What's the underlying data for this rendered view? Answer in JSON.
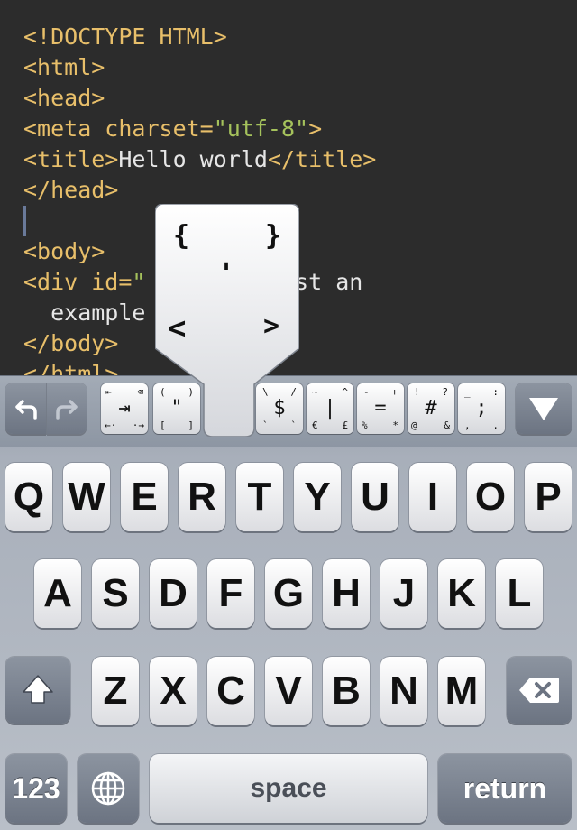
{
  "editor": {
    "lines": [
      {
        "parts": [
          {
            "cls": "tag",
            "text": "<!DOCTYPE HTML>"
          }
        ]
      },
      {
        "parts": [
          {
            "cls": "tag",
            "text": "<html>"
          }
        ]
      },
      {
        "parts": [
          {
            "cls": "tag",
            "text": "<head>"
          }
        ]
      },
      {
        "parts": [
          {
            "cls": "tag",
            "text": "<meta charset="
          },
          {
            "cls": "str",
            "text": "\"utf-8\""
          },
          {
            "cls": "tag",
            "text": ">"
          }
        ]
      },
      {
        "parts": [
          {
            "cls": "tag",
            "text": "<title>"
          },
          {
            "cls": "txt",
            "text": "Hello world"
          },
          {
            "cls": "tag",
            "text": "</title>"
          }
        ]
      },
      {
        "parts": [
          {
            "cls": "tag",
            "text": "</head>"
          }
        ]
      },
      {
        "parts": []
      },
      {
        "parts": [
          {
            "cls": "tag",
            "text": "<body>"
          }
        ]
      },
      {
        "parts": [
          {
            "cls": "tag",
            "text": "<div id="
          },
          {
            "cls": "str",
            "text": "\""
          },
          {
            "cls": "txt",
            "text": "    s is just an"
          }
        ]
      },
      {
        "parts": [
          {
            "cls": "txt",
            "text": "  example"
          }
        ]
      },
      {
        "parts": [
          {
            "cls": "tag",
            "text": "</body>"
          }
        ]
      },
      {
        "parts": [
          {
            "cls": "tag",
            "text": "</html>"
          }
        ]
      }
    ]
  },
  "accessory": {
    "undo_icon": "undo-arrow-icon",
    "redo_icon": "redo-arrow-icon",
    "tab_key": {
      "tl": "⇤",
      "tr": "⌫",
      "center": "⇥",
      "bl": "←·",
      "br": "·→"
    },
    "paren_key": {
      "tl": "(",
      "tr": ")",
      "center": "\"",
      "bl": "[",
      "br": "]"
    },
    "dollar_key": {
      "tl": "\\",
      "tr": "/",
      "center": "$",
      "bl": "`",
      "br": "`"
    },
    "pipe_key": {
      "tl": "~",
      "tr": "^",
      "center": "|",
      "bl": "€",
      "br": "£"
    },
    "equals_key": {
      "tl": "-",
      "tr": "+",
      "center": "=",
      "bl": "%",
      "br": "*"
    },
    "hash_key": {
      "tl": "!",
      "tr": "?",
      "center": "#",
      "bl": "@",
      "br": "&"
    },
    "semicolon_key": {
      "tl": "_",
      "tr": ":",
      "center": ";",
      "bl": ",",
      "br": "."
    },
    "dismiss_icon": "keyboard-dismiss-triangle-icon"
  },
  "popup": {
    "top_left": "{",
    "top_right": "}",
    "center": "'",
    "bottom_left": "<",
    "bottom_right": ">"
  },
  "rows": {
    "row1": [
      "Q",
      "W",
      "E",
      "R",
      "T",
      "Y",
      "U",
      "I",
      "O",
      "P"
    ],
    "row2": [
      "A",
      "S",
      "D",
      "F",
      "G",
      "H",
      "J",
      "K",
      "L"
    ],
    "row3": [
      "Z",
      "X",
      "C",
      "V",
      "B",
      "N",
      "M"
    ]
  },
  "bottom": {
    "numbers": "123",
    "space": "space",
    "return": "return"
  }
}
